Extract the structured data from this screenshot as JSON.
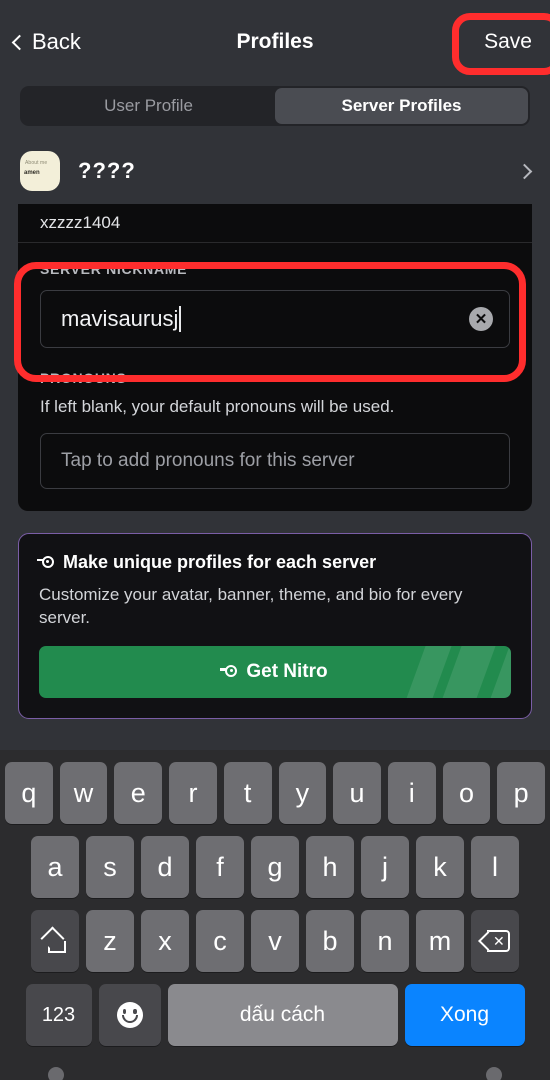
{
  "navbar": {
    "back_label": "Back",
    "title": "Profiles",
    "save_label": "Save"
  },
  "tabs": [
    {
      "label": "User Profile",
      "active": false
    },
    {
      "label": "Server Profiles",
      "active": true
    }
  ],
  "server_row": {
    "name": "????",
    "avatar_line1": "About me",
    "avatar_line2": "amen"
  },
  "scrolled_field": {
    "value": "xzzzz1404"
  },
  "nickname": {
    "label": "SERVER NICKNAME",
    "value": "mavisaurusj",
    "clear_glyph": "✕"
  },
  "pronouns": {
    "label": "PRONOUNS",
    "help": "If left blank, your default pronouns will be used.",
    "placeholder": "Tap to add pronouns for this server"
  },
  "nitro": {
    "heading": "Make unique profiles for each server",
    "subtitle": "Customize your avatar, banner, theme, and bio for every server.",
    "button_label": "Get Nitro",
    "border_color": "#7b5ea7",
    "button_color": "#228b4e"
  },
  "annotations": {
    "highlight_color": "#ff2d2d",
    "targets": [
      "save-button",
      "server-nickname-field"
    ]
  },
  "keyboard": {
    "row1": [
      "q",
      "w",
      "e",
      "r",
      "t",
      "y",
      "u",
      "i",
      "o",
      "p"
    ],
    "row2": [
      "a",
      "s",
      "d",
      "f",
      "g",
      "h",
      "j",
      "k",
      "l"
    ],
    "row3": [
      "z",
      "x",
      "c",
      "v",
      "b",
      "n",
      "m"
    ],
    "shift_icon": "shift-icon",
    "backspace_icon": "backspace-icon",
    "numeric_label": "123",
    "emoji_icon": "emoji-icon",
    "space_label": "dấu cách",
    "done_label": "Xong",
    "done_color": "#0a84ff"
  }
}
